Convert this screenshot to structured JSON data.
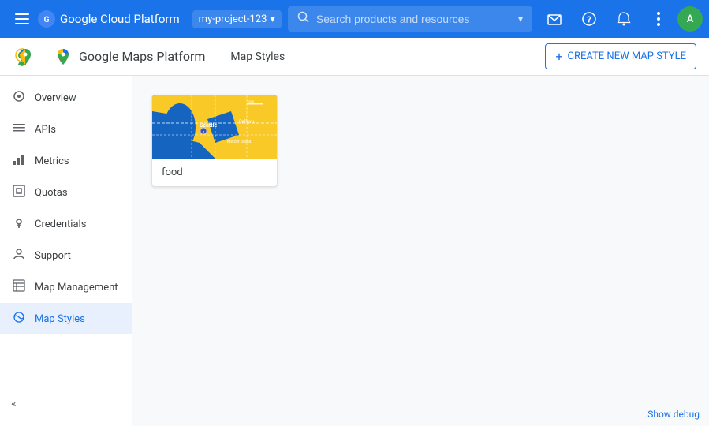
{
  "header": {
    "menu_label": "☰",
    "logo_text": "G",
    "title": "Google Cloud Platform",
    "project_name": "my-project-123",
    "search_placeholder": "Search products and resources",
    "icons": {
      "email": "✉",
      "help": "?",
      "bell": "🔔",
      "more": "⋮"
    },
    "avatar_text": "A"
  },
  "sub_header": {
    "title": "Google Maps Platform",
    "nav_items": [
      "Map Styles"
    ],
    "create_btn_label": "CREATE NEW MAP STYLE",
    "create_icon": "+"
  },
  "sidebar": {
    "items": [
      {
        "id": "overview",
        "label": "Overview",
        "icon": "⊙"
      },
      {
        "id": "apis",
        "label": "APIs",
        "icon": "☰"
      },
      {
        "id": "metrics",
        "label": "Metrics",
        "icon": "📊"
      },
      {
        "id": "quotas",
        "label": "Quotas",
        "icon": "▣"
      },
      {
        "id": "credentials",
        "label": "Credentials",
        "icon": "🔑"
      },
      {
        "id": "support",
        "label": "Support",
        "icon": "👤"
      },
      {
        "id": "map-management",
        "label": "Map Management",
        "icon": "📋"
      },
      {
        "id": "map-styles",
        "label": "Map Styles",
        "icon": "🗺",
        "active": true
      }
    ],
    "collapse_icon": "«"
  },
  "content": {
    "map_style_card": {
      "label": "food",
      "thumbnail_alt": "Map style thumbnail showing Seattle area"
    }
  },
  "bottom": {
    "debug_label": "Show debug"
  }
}
